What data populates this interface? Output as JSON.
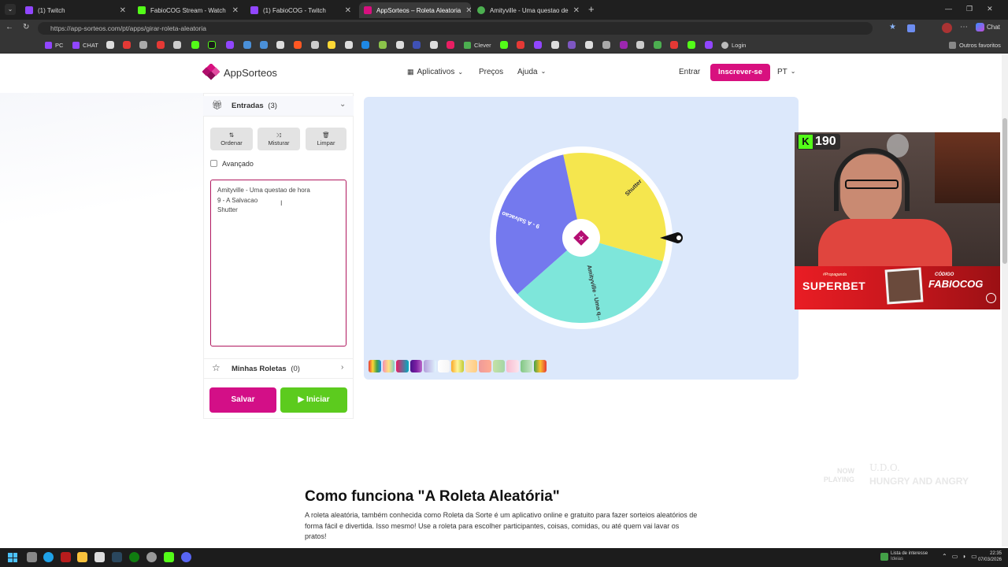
{
  "browser": {
    "tabs": [
      {
        "title": "(1) Twitch",
        "color": "#9146ff"
      },
      {
        "title": "FabioCOG Stream - Watch Live on",
        "color": "#53fc18"
      },
      {
        "title": "(1) FabioCOG - Twitch",
        "color": "#9146ff"
      },
      {
        "title": "AppSorteos – Roleta Aleatoria",
        "color": "#d8107f"
      },
      {
        "title": "Amityville - Uma questao de hora",
        "color": "#4caf50"
      }
    ],
    "url": "https://app-sorteos.com/pt/apps/girar-roleta-aleatoria",
    "bookmarks": [
      {
        "label": "PC",
        "color": "#9146ff"
      },
      {
        "label": "CHAT",
        "color": "#9146ff"
      },
      {
        "label": "Clever",
        "color": "#4caf50"
      },
      {
        "label": "Login",
        "color": "#bbbbbb"
      },
      {
        "label": "Outros favoritos",
        "color": "#888888"
      }
    ],
    "profile_label": "Chat"
  },
  "site": {
    "brand": "AppSorteos",
    "nav": {
      "apps": "Aplicativos",
      "prices": "Preços",
      "help": "Ajuda"
    },
    "login": "Entrar",
    "signup": "Inscrever-se",
    "lang": "PT"
  },
  "panel": {
    "entries_label": "Entradas",
    "entries_count": "(3)",
    "tools": {
      "sort": "Ordenar",
      "shuffle": "Misturar",
      "clear": "Limpar"
    },
    "advanced": "Avançado",
    "entries": [
      "Amityville - Uma questao de hora",
      "9 - A Salvacao",
      "Shutter"
    ],
    "my_wheels": "Minhas Roletas",
    "my_wheels_count": "(0)",
    "save": "Salvar",
    "start": "Iniciar"
  },
  "wheel": {
    "segments": [
      {
        "label": "Shutter",
        "color": "#f5e64e"
      },
      {
        "label": "Amityville - Uma q...",
        "color": "#7ee6da"
      },
      {
        "label": "9 - A Salvacao",
        "color": "#7479ee"
      }
    ]
  },
  "overlay": {
    "kick_count": "190",
    "promo_tag": "#Propaganda",
    "promo_brand": "SUPERBET",
    "code_label": "CÓDIGO",
    "code": "FABIOCOG",
    "now_playing_1": "NOW",
    "now_playing_2": "PLAYING",
    "artist": "U.D.O.",
    "song": "HUNGRY AND ANGRY"
  },
  "section": {
    "title": "Como funciona \"A Roleta Aleatória\"",
    "text": "A roleta aleatória, também conhecida como Roleta da Sorte é um aplicativo online e gratuito para fazer sorteios aleatórios de forma fácil e divertida. Isso mesmo! Use a roleta para escolher participantes, coisas, comidas, ou até quem vai lavar os pratos!"
  },
  "taskbar": {
    "news_1": "Lista de interesse",
    "news_2": "Ideias",
    "time": "22:35",
    "date": "07/03/2026"
  }
}
